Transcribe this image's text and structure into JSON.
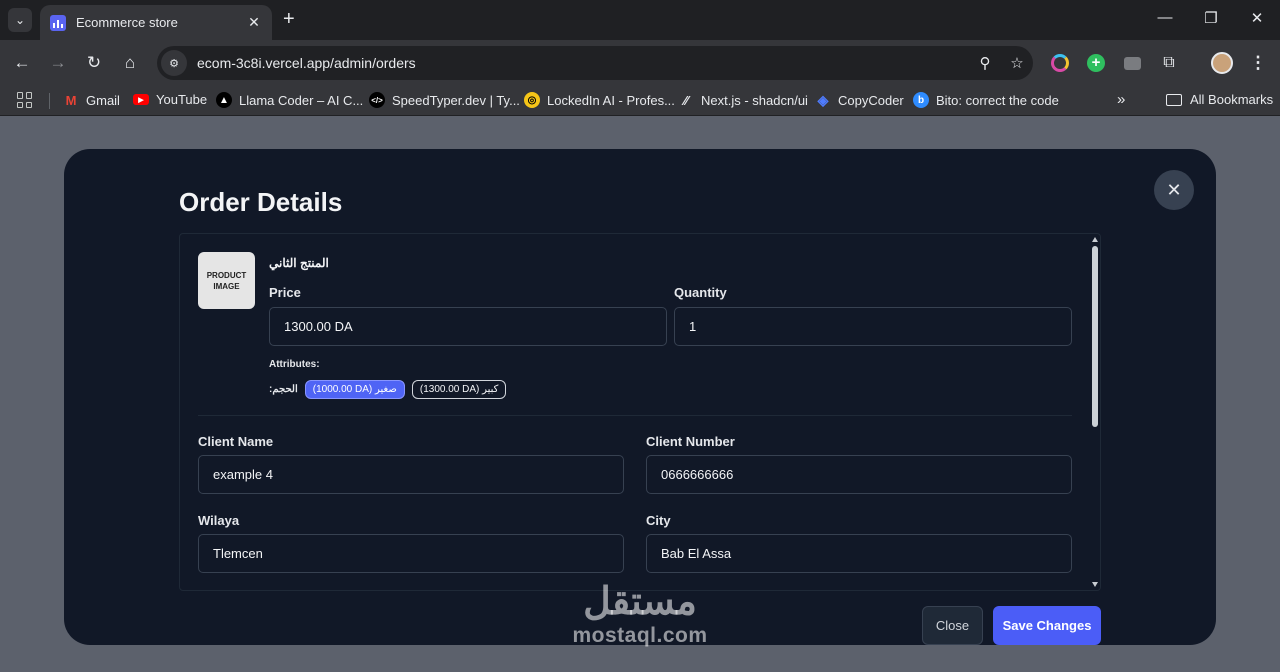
{
  "browser": {
    "tab_title": "Ecommerce store",
    "url": "ecom-3c8i.vercel.app/admin/orders",
    "bookmarks": [
      {
        "label": "Gmail",
        "icon": "gmail-icon",
        "color": "#ea4335"
      },
      {
        "label": "YouTube",
        "icon": "youtube-icon",
        "color": "#ff0000"
      },
      {
        "label": "Llama Coder – AI C...",
        "icon": "llama-icon",
        "color": "#000000"
      },
      {
        "label": "SpeedTyper.dev | Ty...",
        "icon": "code-icon",
        "color": "#000000"
      },
      {
        "label": "LockedIn AI - Profes...",
        "icon": "lockedin-icon",
        "color": "#f5c518"
      },
      {
        "label": "Next.js - shadcn/ui",
        "icon": "shadcn-icon",
        "color": "#000000"
      },
      {
        "label": "CopyCoder",
        "icon": "copycoder-icon",
        "color": "#4f7cff"
      },
      {
        "label": "Bito: correct the code",
        "icon": "bito-icon",
        "color": "#2f8cff"
      }
    ],
    "all_bookmarks": "All Bookmarks"
  },
  "modal": {
    "title": "Order Details",
    "product": {
      "image_text": "PRODUCT IMAGE",
      "name": "المنتج الثاني",
      "price_label": "Price",
      "price_value": "1300.00 DA",
      "quantity_label": "Quantity",
      "quantity_value": "1",
      "attributes_label": "Attributes:",
      "attribute_name": "الحجم:",
      "options": [
        {
          "label": "(1000.00 DA) صغير",
          "selected": true
        },
        {
          "label": "(1300.00 DA) كبير",
          "selected": false
        }
      ]
    },
    "client": {
      "name_label": "Client Name",
      "name_value": "example 4",
      "number_label": "Client Number",
      "number_value": "0666666666",
      "wilaya_label": "Wilaya",
      "wilaya_value": "Tlemcen",
      "city_label": "City",
      "city_value": "Bab El Assa"
    },
    "close_label": "Close",
    "save_label": "Save Changes"
  },
  "watermark": {
    "arabic": "مستقل",
    "latin": "mostaql.com"
  },
  "colors": {
    "accent": "#4b5df7",
    "modal_bg": "#111827",
    "backdrop": "#5c616c"
  }
}
